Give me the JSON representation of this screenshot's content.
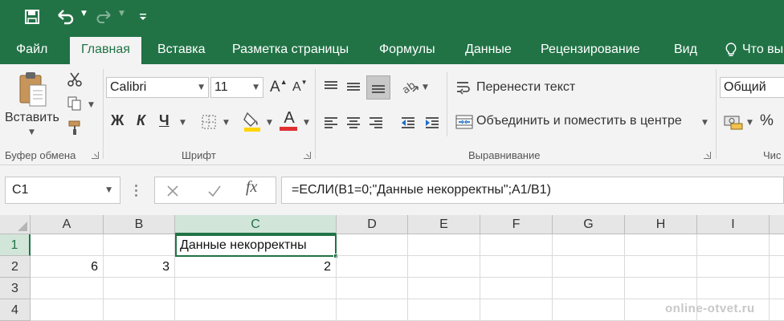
{
  "tabs": [
    "Файл",
    "Главная",
    "Вставка",
    "Разметка страницы",
    "Формулы",
    "Данные",
    "Рецензирование",
    "Вид",
    "Что вы"
  ],
  "ribbon": {
    "paste_label": "Вставить",
    "font_name": "Calibri",
    "font_size": "11",
    "bold": "Ж",
    "italic": "К",
    "underline": "Ч",
    "font_color_glyph": "А",
    "grow_font": "A",
    "shrink_font": "A",
    "wrap_text": "Перенести текст",
    "merge_center": "Объединить и поместить в центре",
    "number_format": "Общий",
    "percent": "%",
    "groups": {
      "clipboard": "Буфер обмена",
      "font": "Шрифт",
      "alignment": "Выравнивание",
      "number": "Чис"
    }
  },
  "formula_bar": {
    "name_box": "C1",
    "formula": "=ЕСЛИ(B1=0;\"Данные некорректны\";A1/B1)"
  },
  "grid": {
    "columns": [
      "A",
      "B",
      "C",
      "D",
      "E",
      "F",
      "G",
      "H",
      "I"
    ],
    "rows": [
      "1",
      "2",
      "3",
      "4"
    ],
    "selected_cell": "C1",
    "cells": {
      "C1": "Данные некорректны",
      "A2": "6",
      "B2": "3",
      "C2": "2"
    }
  },
  "watermark": "online-otvet.ru",
  "colors": {
    "accent": "#217346",
    "ribbon_bg": "#f3f3f3",
    "header_bg": "#e6e6e6",
    "header_selected_bg": "#d2e5d9",
    "font_color_red": "#e03131",
    "fill_yellow": "#ffd500"
  },
  "icons": [
    "save-icon",
    "undo-icon",
    "redo-icon",
    "customize-qat-icon",
    "lightbulb-icon",
    "paste-icon",
    "cut-icon",
    "copy-icon",
    "format-painter-icon",
    "borders-icon",
    "fill-color-icon",
    "align-top-icon",
    "align-middle-icon",
    "align-bottom-icon",
    "orientation-icon",
    "align-left-icon",
    "align-center-icon",
    "align-right-icon",
    "decrease-indent-icon",
    "increase-indent-icon",
    "wrap-text-icon",
    "merge-icon",
    "currency-icon",
    "cancel-icon",
    "enter-icon",
    "insert-function-icon"
  ]
}
